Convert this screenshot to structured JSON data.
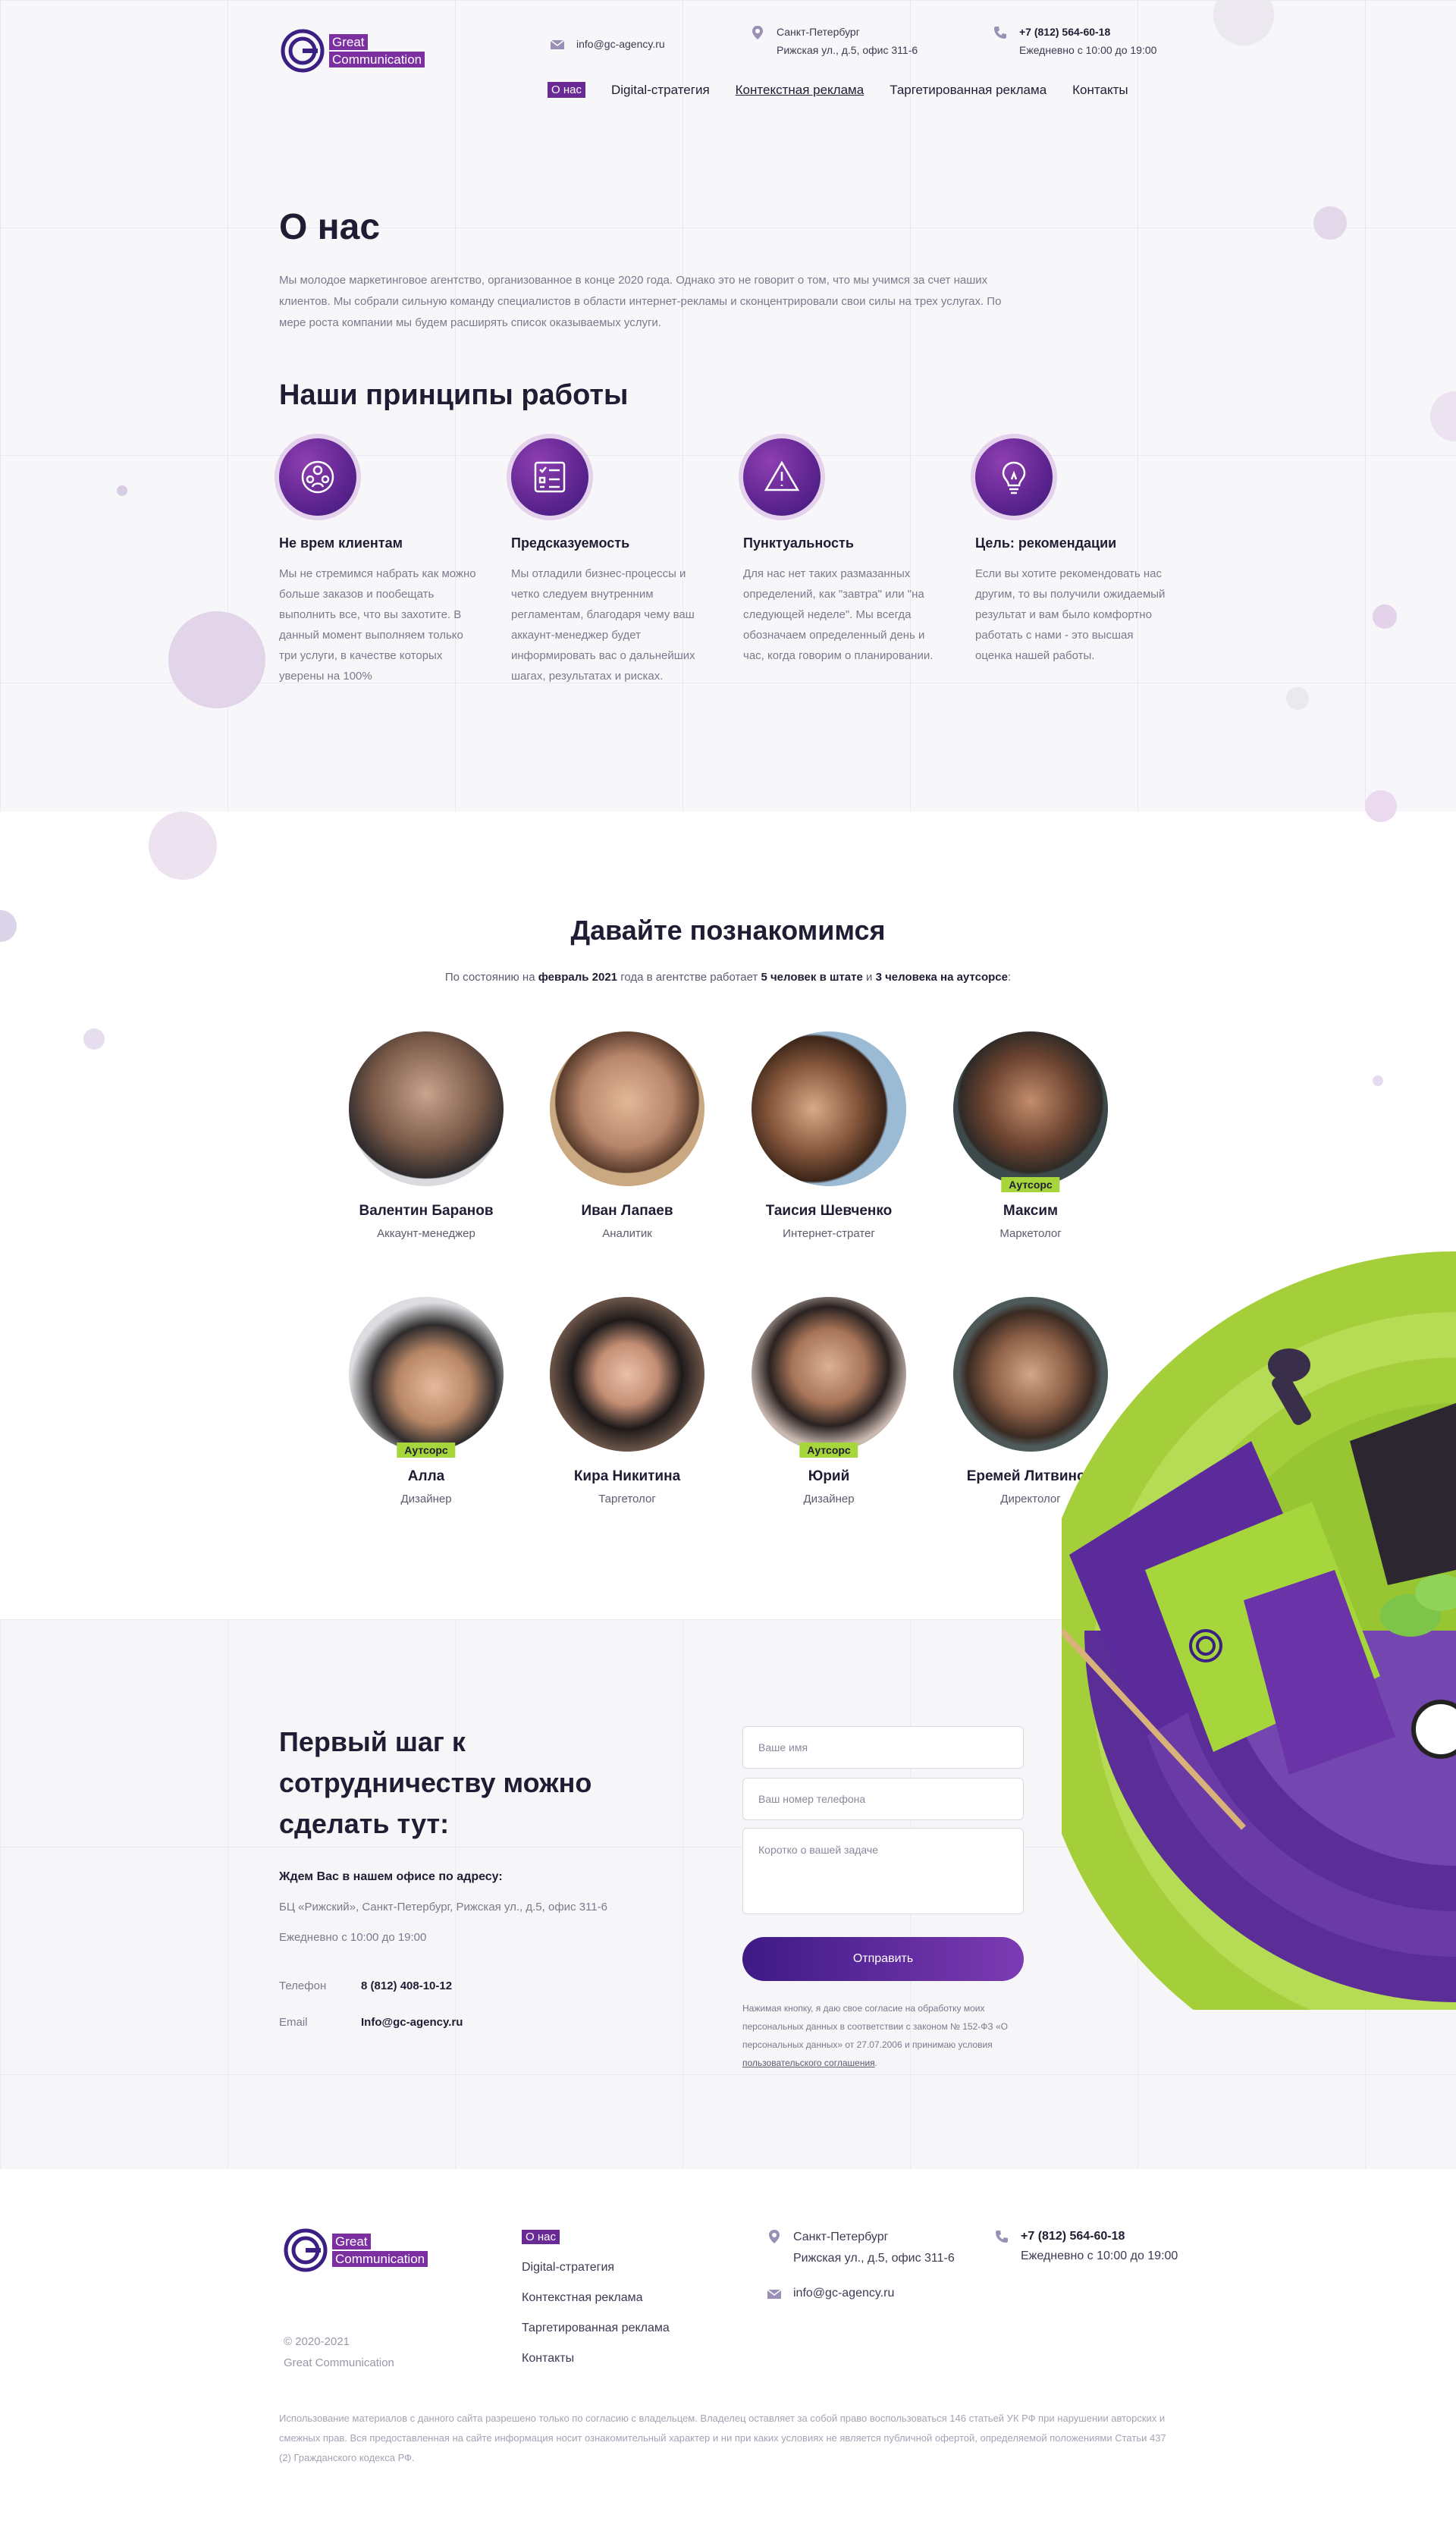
{
  "brand": {
    "line1": "Great",
    "line2": "Communication",
    "color": "#6a2a96",
    "accent": "#a6d63c"
  },
  "header": {
    "email": "info@gc-agency.ru",
    "city": "Санкт-Петербург",
    "address": "Рижская ул., д.5, офис 311-6",
    "phone": "+7 (812) 564-60-18",
    "hours": "Ежедневно с 10:00 до 19:00"
  },
  "nav": {
    "items": [
      {
        "label": "О нас",
        "active": true
      },
      {
        "label": "Digital-стратегия"
      },
      {
        "label": "Контекстная реклама"
      },
      {
        "label": "Таргетированная реклама"
      },
      {
        "label": "Контакты"
      }
    ]
  },
  "about": {
    "title": "О нас",
    "text": "Мы молодое маркетинговое агентство, организованное в конце 2020 года. Однако это не говорит о том, что мы учимся за счет наших клиентов. Мы собрали сильную команду специалистов в области интернет-рекламы и сконцентрировали свои силы на трех услугах. По мере роста компании мы будем расширять список оказываемых услуги."
  },
  "principles": {
    "title": "Наши принципы работы",
    "items": [
      {
        "icon": "people-icon",
        "title": "Не врем клиентам",
        "text": "Мы не стремимся набрать как можно больше заказов и пообещать выполнить все, что вы захотите. В данный момент выполняем только три услуги, в качестве которых уверены на 100%"
      },
      {
        "icon": "checklist-icon",
        "title": "Предсказуемость",
        "text": "Мы отладили бизнес-процессы и четко следуем внутренним регламентам, благодаря чему ваш аккаунт-менеджер будет информировать вас о дальнейших шагах, результатах и рисках."
      },
      {
        "icon": "warning-icon",
        "title": "Пунктуальность",
        "text": "Для нас нет таких размазанных определений, как \"завтра\" или \"на следующей неделе\". Мы всегда обозначаем определенный день и час, когда говорим о планировании."
      },
      {
        "icon": "lightbulb-icon",
        "title": "Цель: рекомендации",
        "text": "Если вы хотите рекомендовать нас другим, то вы получили ожидаемый результат и вам было комфортно работать с нами - это высшая оценка нашей работы."
      }
    ]
  },
  "team": {
    "title": "Давайте познакомимся",
    "intro_prefix": "По состоянию на",
    "intro_date": "февраль 2021",
    "intro_mid": "года в агентстве работает",
    "intro_staff": "5 человек в штате",
    "intro_and": "и",
    "intro_out": "3 человека на аутсорсе",
    "intro_end": ":",
    "badge": "Аутсорс",
    "members": [
      {
        "name": "Валентин Баранов",
        "role": "Аккаунт-менеджер",
        "outsource": false
      },
      {
        "name": "Иван Лапаев",
        "role": "Аналитик",
        "outsource": false
      },
      {
        "name": "Таисия Шевченко",
        "role": "Интернет-стратег",
        "outsource": false
      },
      {
        "name": "Максим",
        "role": "Маркетолог",
        "outsource": true
      },
      {
        "name": "Алла",
        "role": "Дизайнер",
        "outsource": true
      },
      {
        "name": "Кира Никитина",
        "role": "Таргетолог",
        "outsource": false
      },
      {
        "name": "Юрий",
        "role": "Дизайнер",
        "outsource": true
      },
      {
        "name": "Еремей Литвинов",
        "role": "Директолог",
        "outsource": false
      }
    ]
  },
  "contact": {
    "title_l1": "Первый шаг к",
    "title_l2": "сотрудничеству можно",
    "title_l3": "сделать тут:",
    "office_label": "Ждем Вас в нашем офисе по адресу:",
    "office_address": "БЦ «Рижский», Санкт-Петербург, Рижская ул., д.5, офис 311-6",
    "office_hours": "Ежедневно с 10:00 до 19:00",
    "phone_label": "Телефон",
    "phone": "8 (812) 408-10-12",
    "email_label": "Email",
    "email": "Info@gc-agency.ru"
  },
  "form": {
    "name_placeholder": "Ваше имя",
    "phone_placeholder": "Ваш номер телефона",
    "task_placeholder": "Коротко о вашей задаче",
    "submit": "Отправить",
    "consent": "Нажимая кнопку, я даю свое согласие на обработку моих персональных данных в соответствии с законом № 152-ФЗ «О персональных данных» от 27.07.2006 и принимаю условия",
    "consent_link": "пользовательского соглашения",
    "consent_end": "."
  },
  "footer": {
    "copyright_years": "© 2020-2021",
    "copyright_name": "Great Communication",
    "nav": [
      "О нас",
      "Digital-стратегия",
      "Контекстная реклама",
      "Таргетированная реклама",
      "Контакты"
    ],
    "city": "Санкт-Петербург",
    "address": "Рижская ул., д.5, офис 311-6",
    "email": "info@gc-agency.ru",
    "phone": "+7 (812) 564-60-18",
    "hours": "Ежедневно с 10:00 до 19:00",
    "legal": "Использование материалов с данного сайта разрешено только по согласию с владельцем. Владелец оставляет за собой право воспользоваться 146 статьей УК РФ при нарушении авторских и смежных прав. Вся предоставленная на сайте информация носит ознакомительный характер и ни при каких условиях не является публичной офертой, определяемой положениями Статьи 437 (2) Гражданского кодекса РФ."
  }
}
